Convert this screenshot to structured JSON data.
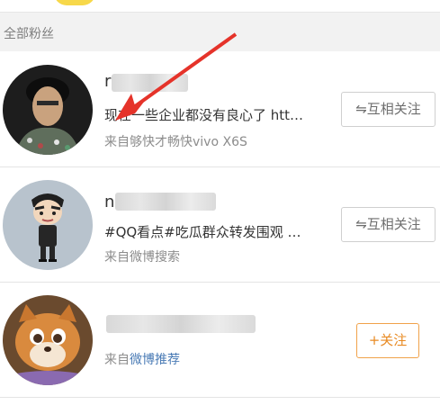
{
  "section_header": "全部粉丝",
  "fans": [
    {
      "name_visible": "r",
      "description": "现在一些企业都没有良心了 htt…",
      "source_prefix": "来自",
      "source_value": "够快才畅快vivo X6S",
      "action_label": "互相关注",
      "action_icon": "mutual-arrows-icon"
    },
    {
      "name_visible": "n",
      "description": "#QQ看点#吃瓜群众转发围观 …",
      "source_prefix": "来自",
      "source_value": "微博搜索",
      "action_label": "互相关注",
      "action_icon": "mutual-arrows-icon"
    },
    {
      "name_visible": "",
      "description": "",
      "source_prefix": "来自",
      "source_value": "微博推荐",
      "action_label": "关注",
      "action_icon": "plus-icon"
    }
  ],
  "colors": {
    "accent_orange": "#e88a22",
    "link_blue": "#4a7bb5",
    "annotation_red": "#e5332a"
  }
}
